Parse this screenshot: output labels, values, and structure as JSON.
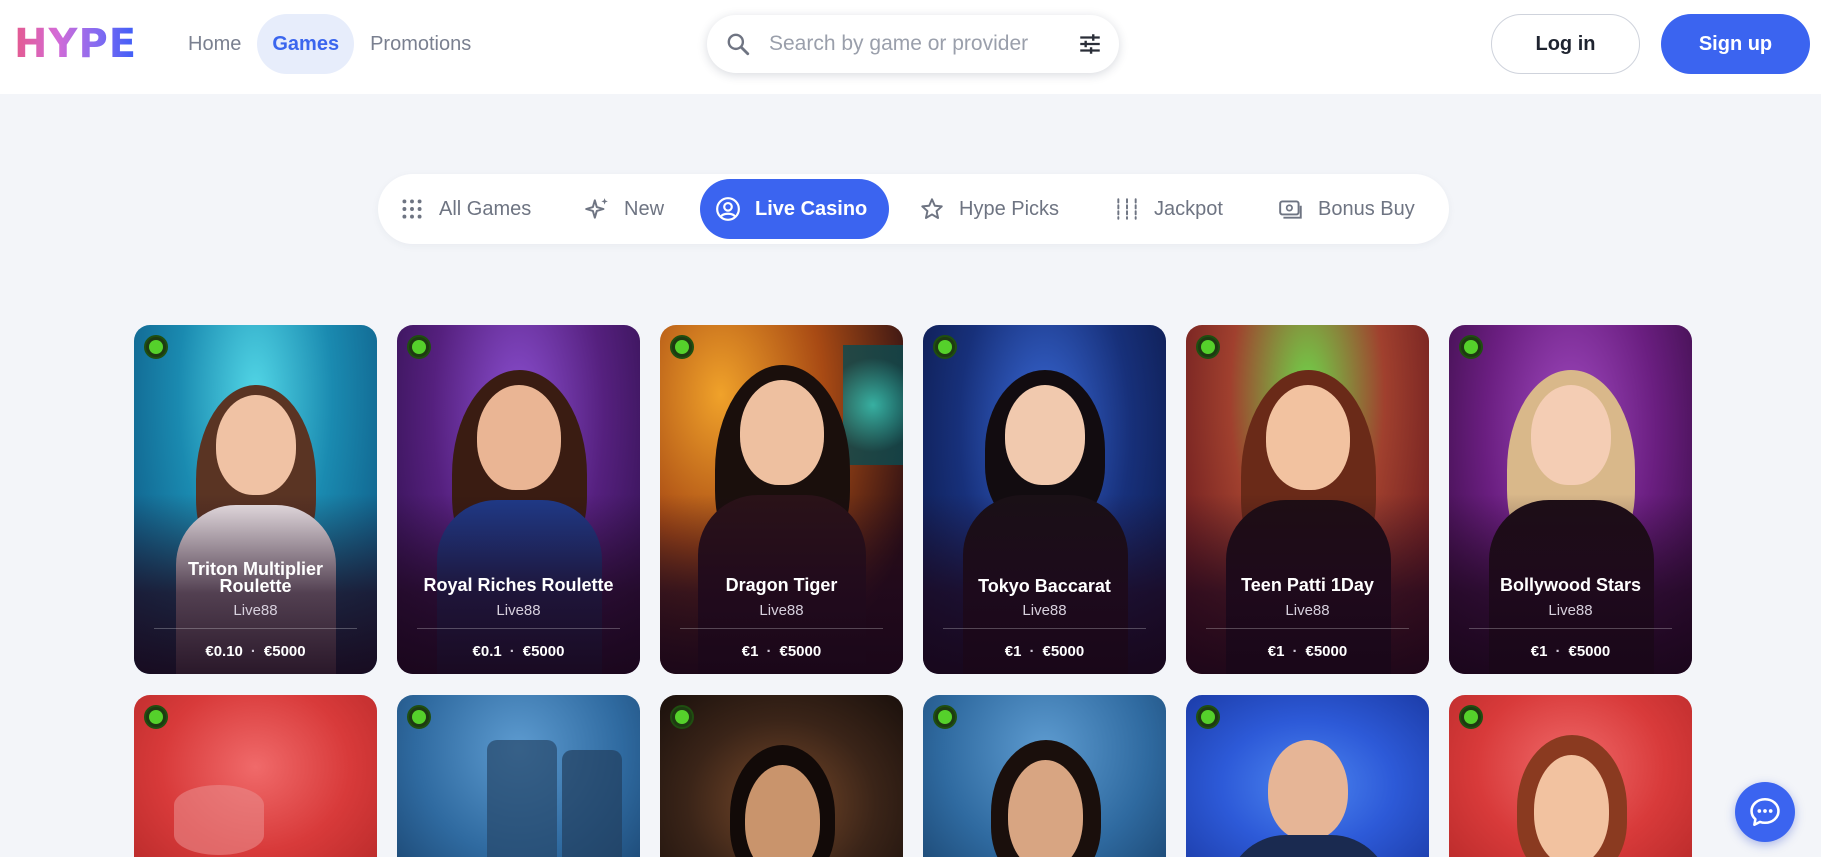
{
  "header": {
    "logo_text": "HYPE",
    "nav": [
      {
        "label": "Home",
        "active": false
      },
      {
        "label": "Games",
        "active": true
      },
      {
        "label": "Promotions",
        "active": false
      }
    ],
    "search": {
      "placeholder": "Search by game or provider",
      "value": ""
    },
    "login_label": "Log in",
    "signup_label": "Sign up"
  },
  "categories": [
    {
      "label": "All Games",
      "icon": "grid-icon",
      "active": false
    },
    {
      "label": "New",
      "icon": "sparkle-icon",
      "active": false
    },
    {
      "label": "Live Casino",
      "icon": "user-circle-icon",
      "active": true
    },
    {
      "label": "Hype Picks",
      "icon": "star-icon",
      "active": false
    },
    {
      "label": "Jackpot",
      "icon": "sliders-icon",
      "active": false
    },
    {
      "label": "Bonus Buy",
      "icon": "cash-icon",
      "active": false
    }
  ],
  "games": [
    {
      "title_lines": [
        "Triton Multiplier",
        "Roulette"
      ],
      "provider": "Live88",
      "min": "€0.10",
      "max": "€5000",
      "live": true
    },
    {
      "title_lines": [
        "Royal Riches Roulette"
      ],
      "provider": "Live88",
      "min": "€0.1",
      "max": "€5000",
      "live": true
    },
    {
      "title_lines": [
        "Dragon Tiger"
      ],
      "provider": "Live88",
      "min": "€1",
      "max": "€5000",
      "live": true
    },
    {
      "title_lines": [
        "Tokyo Baccarat"
      ],
      "provider": "Live88",
      "min": "€1",
      "max": "€5000",
      "live": true
    },
    {
      "title_lines": [
        "Teen Patti 1Day"
      ],
      "provider": "Live88",
      "min": "€1",
      "max": "€5000",
      "live": true
    },
    {
      "title_lines": [
        "Bollywood Stars"
      ],
      "provider": "Live88",
      "min": "€1",
      "max": "€5000",
      "live": true
    }
  ],
  "colors": {
    "accent": "#3b64f0",
    "live": "#55d12b",
    "logo_gradient": [
      "#e45a8e",
      "#3b5ef8"
    ]
  },
  "chat_icon": "chat-bubble-icon"
}
